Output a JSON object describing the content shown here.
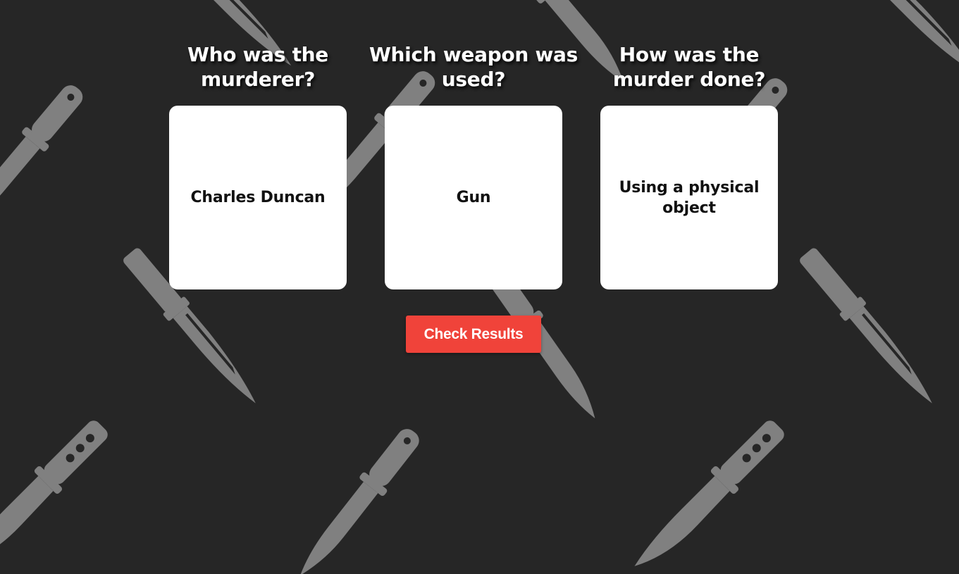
{
  "colors": {
    "background": "#262626",
    "pattern": "#808080",
    "card": "#ffffff",
    "button": "#f0433a"
  },
  "background_pattern": {
    "icon": "knife-icon"
  },
  "questions": [
    {
      "title": "Who was the murderer?",
      "answer": "Charles Duncan"
    },
    {
      "title": "Which weapon was used?",
      "answer": "Gun"
    },
    {
      "title": "How was the murder done?",
      "answer": "Using a physical object"
    }
  ],
  "check_button": {
    "label": "Check Results"
  }
}
